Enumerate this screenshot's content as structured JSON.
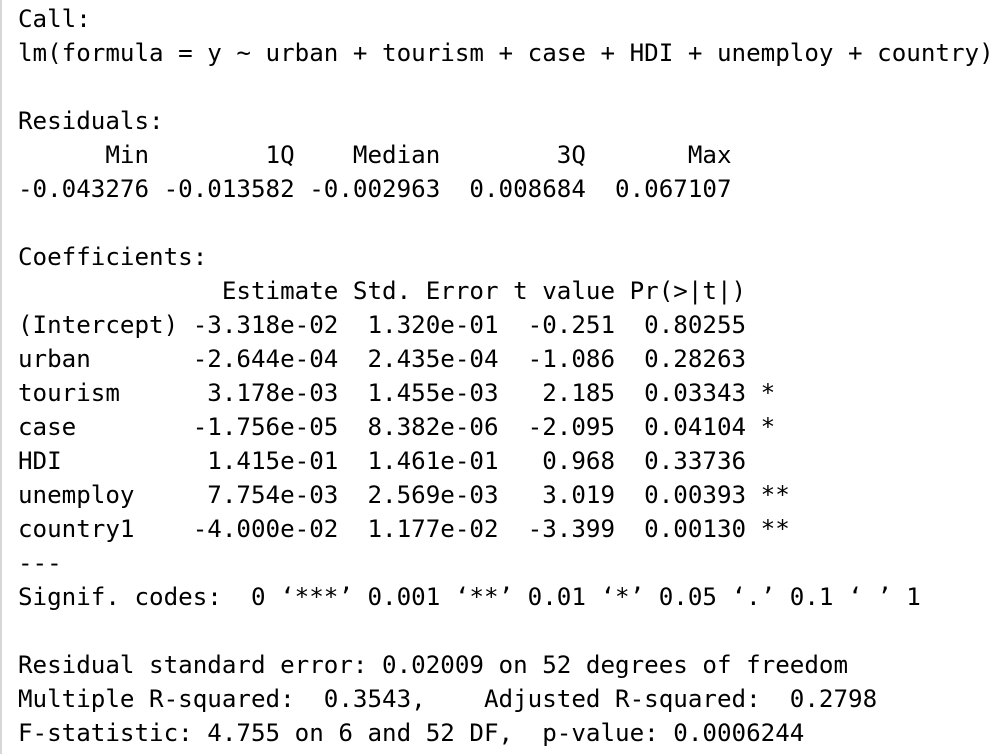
{
  "console_output": {
    "lines": [
      "Call:",
      "lm(formula = y ~ urban + tourism + case + HDI + unemploy + country)",
      "",
      "Residuals:",
      "      Min        1Q    Median        3Q       Max ",
      "-0.043276 -0.013582 -0.002963  0.008684  0.067107 ",
      "",
      "Coefficients:",
      "              Estimate Std. Error t value Pr(>|t|)   ",
      "(Intercept) -3.318e-02  1.320e-01  -0.251  0.80255   ",
      "urban       -2.644e-04  2.435e-04  -1.086  0.28263   ",
      "tourism      3.178e-03  1.455e-03   2.185  0.03343 * ",
      "case        -1.756e-05  8.382e-06  -2.095  0.04104 * ",
      "HDI          1.415e-01  1.461e-01   0.968  0.33736   ",
      "unemploy     7.754e-03  2.569e-03   3.019  0.00393 **",
      "country1    -4.000e-02  1.177e-02  -3.399  0.00130 **",
      "---",
      "Signif. codes:  0 ‘***’ 0.001 ‘**’ 0.01 ‘*’ 0.05 ‘.’ 0.1 ‘ ’ 1",
      "",
      "Residual standard error: 0.02009 on 52 degrees of freedom",
      "Multiple R-squared:  0.3543,\tAdjusted R-squared:  0.2798 ",
      "F-statistic: 4.755 on 6 and 52 DF,  p-value: 0.0006244"
    ]
  }
}
